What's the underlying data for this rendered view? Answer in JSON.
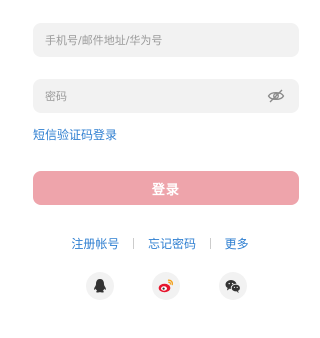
{
  "account": {
    "placeholder": "手机号/邮件地址/华为号",
    "value": ""
  },
  "password": {
    "placeholder": "密码",
    "value": "",
    "visibility_icon": "eye-hidden-icon"
  },
  "sms_login_link": "短信验证码登录",
  "login_button": {
    "label": "登录",
    "color": "#eea4ab"
  },
  "links": {
    "register": "注册帐号",
    "forgot_password": "忘记密码",
    "more": "更多"
  },
  "social_login": [
    {
      "icon": "qq-icon"
    },
    {
      "icon": "weibo-icon"
    },
    {
      "icon": "wechat-icon"
    }
  ],
  "colors": {
    "link": "#2f7fd1",
    "field_background": "#f2f2f2"
  }
}
